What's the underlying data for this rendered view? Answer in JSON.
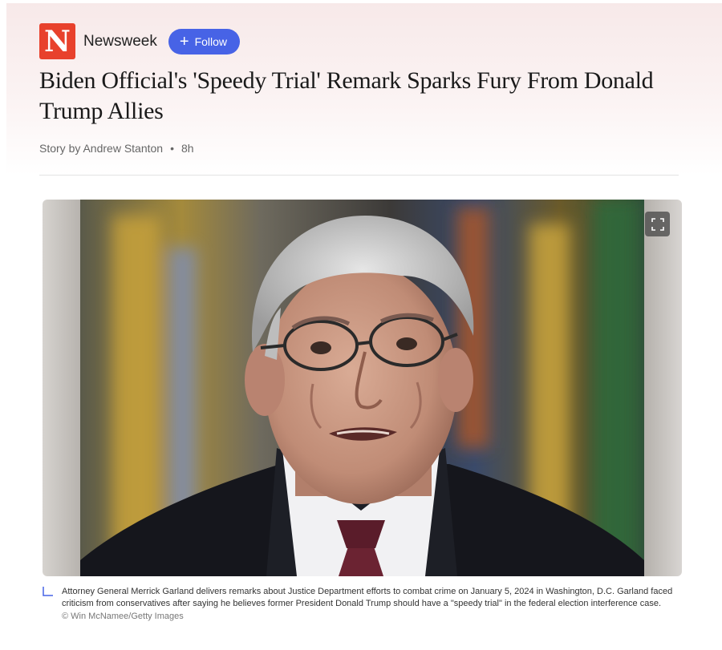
{
  "publisher": {
    "logo_letter": "N",
    "name": "Newsweek",
    "brand_color": "#e8412c"
  },
  "follow": {
    "icon": "plus-icon",
    "label": "Follow",
    "color": "#4763e6"
  },
  "article": {
    "headline": "Biden Official's 'Speedy Trial' Remark Sparks Fury From Donald Trump Allies",
    "byline": "Story by Andrew Stanton",
    "separator": "•",
    "age": "8h"
  },
  "image": {
    "expand_icon": "expand-icon",
    "caption": "Attorney General Merrick Garland delivers remarks about Justice Department efforts to combat crime on January 5, 2024 in Washington, D.C. Garland faced criticism from conservatives after saying he believes former President Donald Trump should have a \"speedy trial\" in the federal election interference case.",
    "credit": "© Win McNamee/Getty Images"
  }
}
